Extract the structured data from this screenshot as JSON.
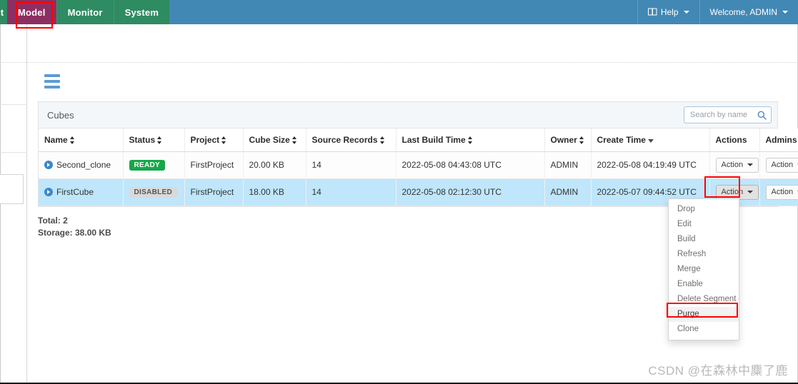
{
  "navbar": {
    "partial_tab_label": "t",
    "tabs": [
      {
        "label": "Model",
        "active": true
      },
      {
        "label": "Monitor",
        "active": false
      },
      {
        "label": "System",
        "active": false
      }
    ],
    "help_label": "Help",
    "user_label": "Welcome, ADMIN",
    "colors": {
      "green": "#2e8b62",
      "blue": "#4288b5",
      "active_tab": "#8e2f63",
      "highlight": "#ff0000"
    }
  },
  "menu_toggle": {
    "name": "hamburger-menu"
  },
  "panel": {
    "title": "Cubes",
    "search": {
      "placeholder": "Search by name",
      "value": ""
    }
  },
  "table": {
    "columns": [
      {
        "label": "Name",
        "sort": "both"
      },
      {
        "label": "Status",
        "sort": "both"
      },
      {
        "label": "Project",
        "sort": "both"
      },
      {
        "label": "Cube Size",
        "sort": "both"
      },
      {
        "label": "Source Records",
        "sort": "both"
      },
      {
        "label": "Last Build Time",
        "sort": "both"
      },
      {
        "label": "Owner",
        "sort": "both"
      },
      {
        "label": "Create Time",
        "sort": "desc"
      },
      {
        "label": "Actions",
        "sort": "none"
      },
      {
        "label": "Admins",
        "sort": "none"
      }
    ],
    "rows": [
      {
        "name": "Second_clone",
        "status": "READY",
        "status_kind": "ready",
        "project": "FirstProject",
        "cube_size": "20.00 KB",
        "source_records": "14",
        "last_build_time": "2022-05-08 04:43:08 UTC",
        "owner": "ADMIN",
        "create_time": "2022-05-08 04:19:49 UTC",
        "action_label": "Action",
        "admin_label": "Action",
        "selected": false
      },
      {
        "name": "FirstCube",
        "status": "DISABLED",
        "status_kind": "disabled",
        "project": "FirstProject",
        "cube_size": "18.00 KB",
        "source_records": "14",
        "last_build_time": "2022-05-08 02:12:30 UTC",
        "owner": "ADMIN",
        "create_time": "2022-05-07 09:44:52 UTC",
        "action_label": "Action",
        "admin_label": "Action",
        "selected": true
      }
    ]
  },
  "action_dropdown": {
    "items": [
      {
        "label": "Drop",
        "hover": false
      },
      {
        "label": "Edit",
        "hover": false
      },
      {
        "label": "Build",
        "hover": false
      },
      {
        "label": "Refresh",
        "hover": false
      },
      {
        "label": "Merge",
        "hover": false
      },
      {
        "label": "Enable",
        "hover": false
      },
      {
        "label": "Delete Segment",
        "hover": false
      },
      {
        "label": "Purge",
        "hover": true
      },
      {
        "label": "Clone",
        "hover": false
      }
    ]
  },
  "totals": {
    "total": "Total: 2",
    "storage": "Storage: 38.00 KB"
  },
  "watermark": "CSDN @在森林中麋了鹿"
}
